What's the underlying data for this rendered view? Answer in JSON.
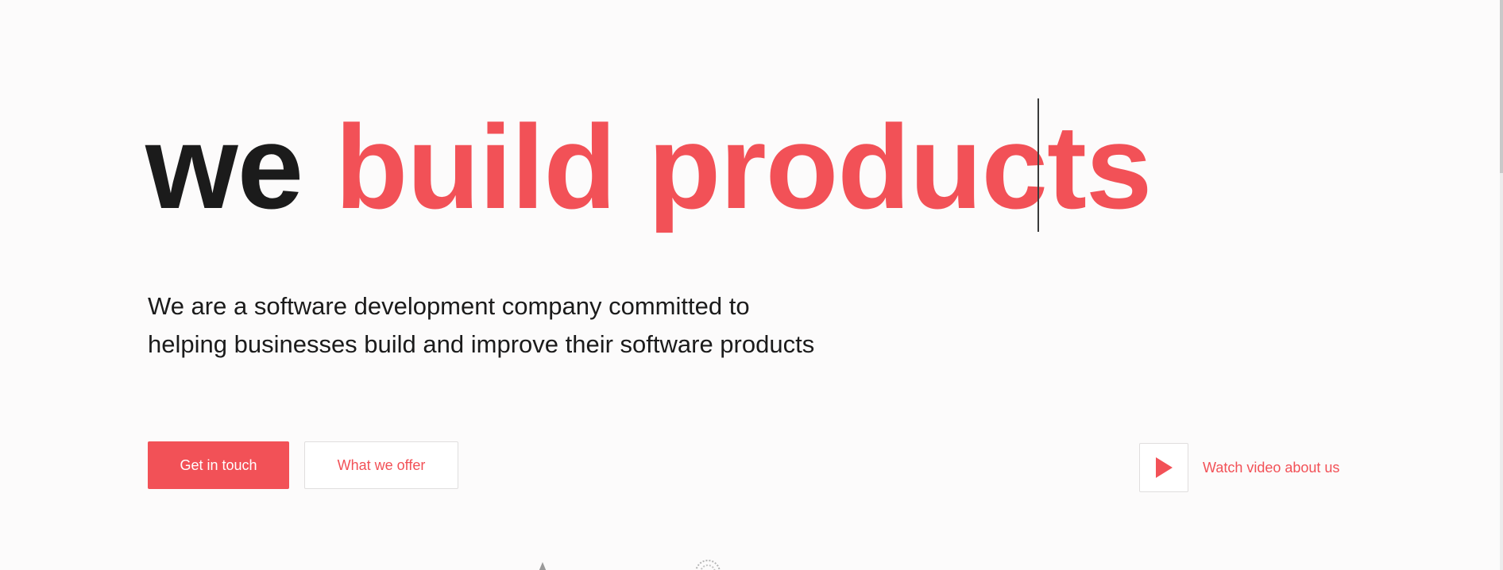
{
  "hero": {
    "title_dark": "we ",
    "title_accent": "build products",
    "description": "We are a software development company committed to helping businesses build and improve their software products"
  },
  "actions": {
    "primary_label": "Get in touch",
    "secondary_label": "What we offer"
  },
  "video": {
    "label": "Watch video about us",
    "icon": "play-icon"
  },
  "colors": {
    "accent": "#f25157",
    "text": "#1b1b1b",
    "background": "#fcfbfb"
  }
}
